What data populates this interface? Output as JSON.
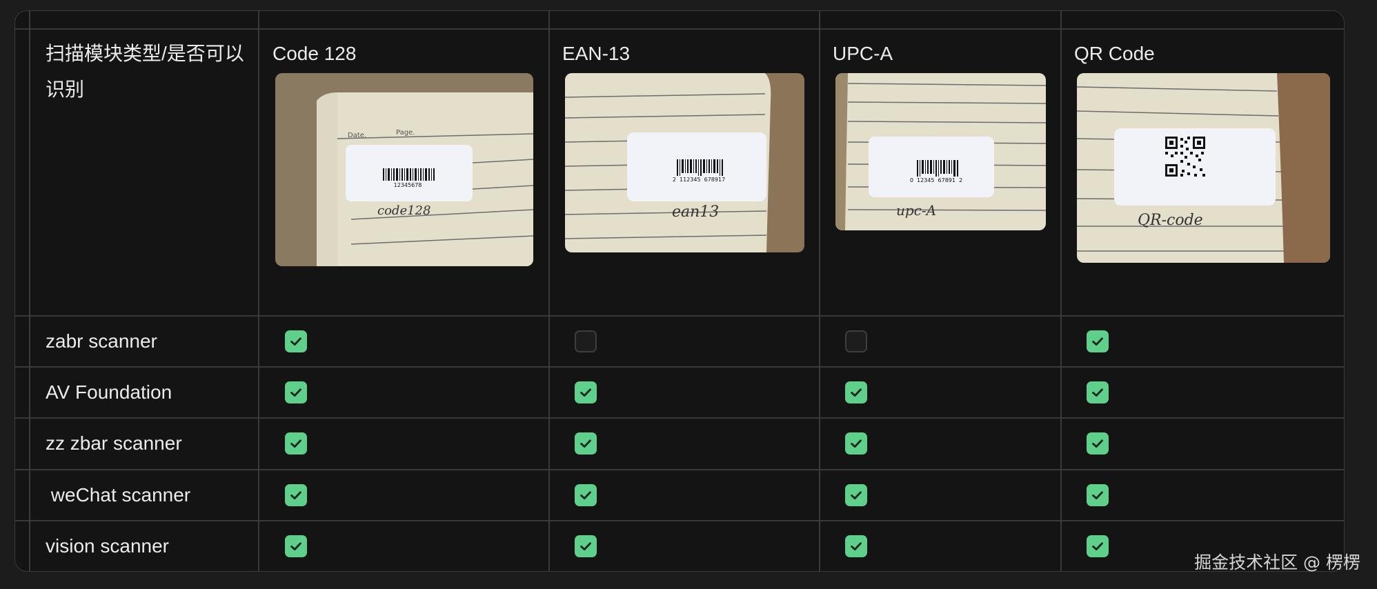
{
  "table": {
    "corner_label": "扫描模块类型/是否可以识别",
    "columns": [
      {
        "name": "Code 128",
        "handwriting": "code128",
        "digits": "12345678"
      },
      {
        "name": "EAN-13",
        "handwriting": "ean13",
        "digits": "2  112345  678917"
      },
      {
        "name": "UPC-A",
        "handwriting": "upc-A",
        "digits": "0  12345  67891  2"
      },
      {
        "name": "QR Code",
        "handwriting": "QR-code",
        "digits": ""
      }
    ],
    "rows": [
      {
        "name": "zabr scanner",
        "support": [
          true,
          false,
          false,
          true
        ]
      },
      {
        "name": "AV Foundation",
        "support": [
          true,
          true,
          true,
          true
        ]
      },
      {
        "name": "zz zbar scanner",
        "support": [
          true,
          true,
          true,
          true
        ]
      },
      {
        "name": " weChat scanner",
        "support": [
          true,
          true,
          true,
          true
        ]
      },
      {
        "name": "vision scanner",
        "support": [
          true,
          true,
          true,
          true
        ]
      }
    ]
  },
  "photo_labels": {
    "date": "Date.",
    "page": "Page."
  },
  "watermark": "掘金技术社区 @ 楞楞",
  "colors": {
    "check_on": "#5fcf8c",
    "check_off_border": "#3e3e40",
    "grid": "#3a3a3c",
    "background": "#141414"
  }
}
